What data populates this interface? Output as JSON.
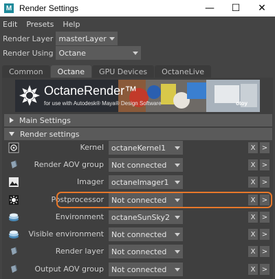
{
  "window": {
    "app_icon_letter": "M",
    "title": "Render Settings",
    "controls": [
      "—",
      "☐",
      "✕"
    ]
  },
  "menu": [
    "Edit",
    "Presets",
    "Help"
  ],
  "render_layer": {
    "label": "Render Layer",
    "value": "masterLayer"
  },
  "render_using": {
    "label": "Render Using",
    "value": "Octane"
  },
  "tabs": [
    {
      "label": "Common",
      "active": false
    },
    {
      "label": "Octane",
      "active": true
    },
    {
      "label": "GPU Devices",
      "active": false
    },
    {
      "label": "OctaneLive",
      "active": false
    }
  ],
  "banner": {
    "title": "OctaneRender™",
    "subtitle": "for use with Autodesk® Maya® Design Software",
    "brand": "otoy"
  },
  "sections": {
    "main": "Main Settings",
    "render": "Render settings"
  },
  "attributes": [
    {
      "label": "Kernel",
      "value": "octaneKernel1",
      "icon": "kernel-icon"
    },
    {
      "label": "Render AOV group",
      "value": "Not connected",
      "icon": "aov-icon"
    },
    {
      "label": "Imager",
      "value": "octaneImager1",
      "icon": "imager-icon"
    },
    {
      "label": "Postprocessor",
      "value": "Not connected",
      "icon": "postprocessor-icon"
    },
    {
      "label": "Environment",
      "value": "octaneSunSky2",
      "icon": "environment-icon"
    },
    {
      "label": "Visible environment",
      "value": "Not connected",
      "icon": "visible-environment-icon"
    },
    {
      "label": "Render layer",
      "value": "Not connected",
      "icon": "render-layer-icon"
    },
    {
      "label": "Output AOV group",
      "value": "Not connected",
      "icon": "output-aov-icon"
    }
  ],
  "row_buttons": {
    "clear": "X",
    "go": ">"
  },
  "colors": {
    "highlight": "#e8782a",
    "background": "#444444"
  }
}
